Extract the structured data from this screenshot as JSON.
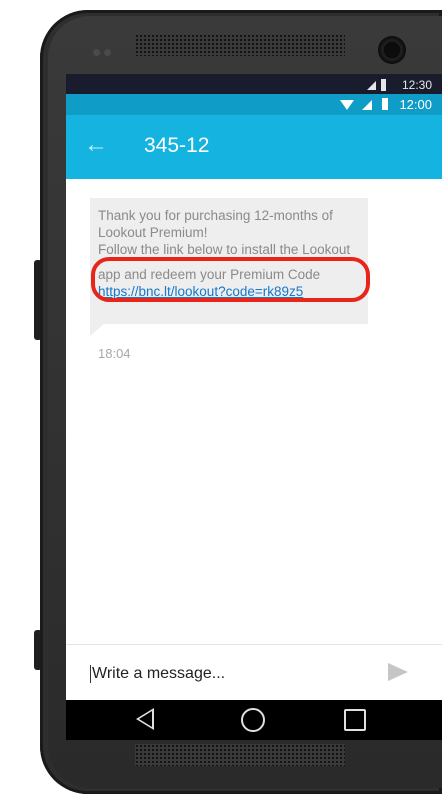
{
  "status_bar_outer": {
    "time": "12:30"
  },
  "status_bar": {
    "time": "12:00"
  },
  "toolbar": {
    "title": "345-12",
    "back_icon": "arrow-left-icon"
  },
  "message": {
    "lines": [
      "Thank you for purchasing 12-months of",
      "Lookout Premium!",
      "Follow the link below to install the Lookout",
      "app and redeem your Premium Code"
    ],
    "link": "https://bnc.lt/lookout?code=rk89z5",
    "time": "18:04",
    "highlight_color": "#e8251b"
  },
  "compose": {
    "value": "Write a message...",
    "send_icon": "send-icon"
  },
  "nav_bar": {
    "back_icon": "triangle-back-icon",
    "home_icon": "circle-home-icon",
    "recents_icon": "square-recents-icon"
  },
  "colors": {
    "toolbar": "#15b3e0",
    "status_bar": "#0f9cc6",
    "bubble": "#eeeeee",
    "link": "#1578c8"
  }
}
